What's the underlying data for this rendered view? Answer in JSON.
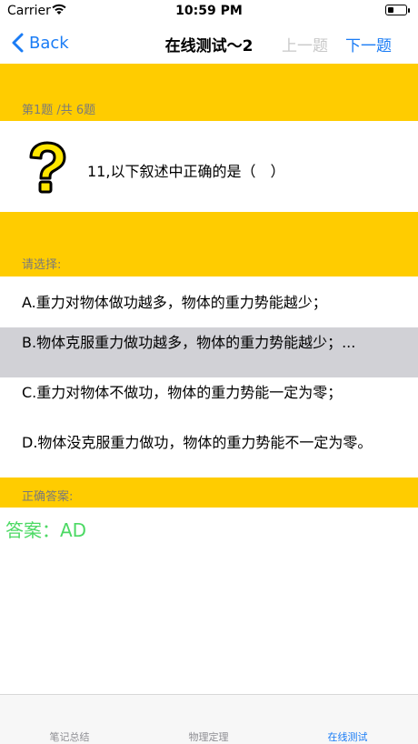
{
  "status": {
    "carrier": "Carrier",
    "time": "10:59 PM"
  },
  "nav": {
    "back": "Back",
    "title": "在线测试～2",
    "prev": "上一题",
    "next": "下一题"
  },
  "question": {
    "counter": "第1题 /共 6题",
    "text": "11,以下叙述中正确的是（　）"
  },
  "choose_label": "请选择:",
  "options": [
    {
      "text": "A.重力对物体做功越多，物体的重力势能越少；"
    },
    {
      "text": "B.物体克服重力做功越多，物体的重力势能越少；..."
    },
    {
      "text": "C.重力对物体不做功，物体的重力势能一定为零；"
    },
    {
      "text": "D.物体没克服重力做功，物体的重力势能不一定为零。"
    }
  ],
  "selected_option": "B",
  "answer_label": "正确答案:",
  "answer": "答案：AD",
  "tabs": [
    {
      "label": "笔记总结"
    },
    {
      "label": "物理定理"
    },
    {
      "label": "在线测试"
    }
  ],
  "colors": {
    "accent": "#1a7cf5",
    "header_yellow": "#ffcc00",
    "selected_row": "#d1d1d6",
    "answer_green": "#4cd964"
  }
}
